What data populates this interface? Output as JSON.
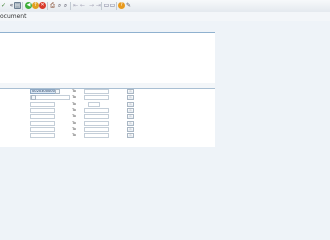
{
  "toolbar": {
    "icons": [
      {
        "name": "check-icon",
        "glyph": "✓"
      },
      {
        "name": "back-icon",
        "glyph": "«"
      },
      {
        "name": "save-icon",
        "glyph": "▤"
      },
      {
        "name": "back-green-icon",
        "glyph": "◀"
      },
      {
        "name": "exit-icon",
        "glyph": "↑"
      },
      {
        "name": "cancel-icon",
        "glyph": "✕"
      },
      {
        "name": "print-icon",
        "glyph": "⎙"
      },
      {
        "name": "find-icon",
        "glyph": "⌕"
      },
      {
        "name": "find-next-icon",
        "glyph": "⌕"
      },
      {
        "name": "first-page-icon",
        "glyph": "⇤"
      },
      {
        "name": "previous-page-icon",
        "glyph": "←"
      },
      {
        "name": "next-page-icon",
        "glyph": "→"
      },
      {
        "name": "last-page-icon",
        "glyph": "⇥"
      },
      {
        "name": "new-session-icon",
        "glyph": "▭"
      },
      {
        "name": "shortcut-icon",
        "glyph": "▭"
      },
      {
        "name": "help-icon",
        "glyph": "?"
      },
      {
        "name": "customize-layout-icon",
        "glyph": "✎"
      }
    ]
  },
  "title": "ocument",
  "selection": {
    "to_label": "To",
    "multi_label": "⇨",
    "rows": [
      {
        "low": "0020300000",
        "high": ""
      },
      {
        "low": "",
        "high": ""
      },
      {
        "low": "",
        "high": ""
      },
      {
        "low": "",
        "high": ""
      },
      {
        "low": "",
        "high": ""
      },
      {
        "low": "",
        "high": ""
      },
      {
        "low": "",
        "high": ""
      },
      {
        "low": "",
        "high": ""
      }
    ]
  },
  "colors": {
    "background": "#eef3f8",
    "panel": "#ffffff",
    "panel_border": "#8fb1cf",
    "filled_field": "#d9e6f4"
  }
}
